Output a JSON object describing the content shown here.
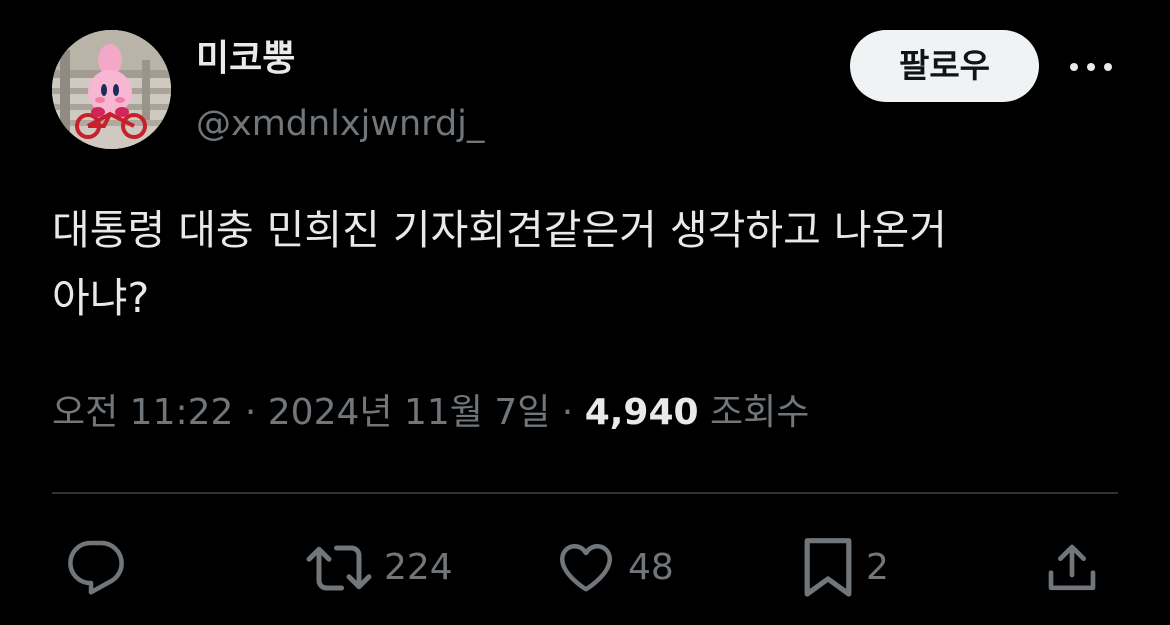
{
  "user": {
    "display_name": "미코뿡",
    "handle": "@xmdnlxjwnrdj_",
    "avatar_icon": "kirby-on-bicycle-avatar"
  },
  "follow_button": {
    "label": "팔로우"
  },
  "more_icon": "more-horizontal-icon",
  "tweet": {
    "text_line1": "대통령 대충 민희진 기자회견같은거 생각하고 나온거",
    "text_line2": "아냐?"
  },
  "meta": {
    "time": "오전 11:22",
    "separator1": " · ",
    "date": "2024년 11월 7일",
    "separator2": " · ",
    "views_count": "4,940",
    "views_label": " 조회수"
  },
  "actions": {
    "reply": {
      "icon": "reply-icon"
    },
    "retweet": {
      "icon": "retweet-icon",
      "count": "224"
    },
    "like": {
      "icon": "heart-icon",
      "count": "48"
    },
    "bookmark": {
      "icon": "bookmark-icon",
      "count": "2"
    },
    "share": {
      "icon": "share-icon"
    }
  },
  "colors": {
    "background": "#000000",
    "primary_text": "#e7e9ea",
    "secondary_text": "#71767b",
    "divider": "#2f3336",
    "follow_bg": "#eff3f4"
  }
}
